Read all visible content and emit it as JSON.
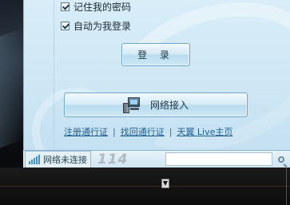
{
  "login": {
    "remember_password": "记住我的密码",
    "auto_login": "自动为我登录",
    "login_button": "登 录",
    "network_button": "网络接入"
  },
  "links": {
    "register": "注册通行证",
    "recover": "找回通行证",
    "tianyi_home": "天翼 Live主页",
    "separator": "|"
  },
  "statusbar": {
    "connection_status": "网络未连接",
    "number_label": "114",
    "search_value": ""
  },
  "icons": {
    "checkbox": "checkmark-icon",
    "network": "network-computer-icon",
    "signal": "signal-bars-icon",
    "search": "search-icon",
    "scroll": "chevron-down-icon"
  },
  "colors": {
    "panel_bg": "#cfe7f5",
    "link": "#1d5f93",
    "signal": "#3f92c9"
  }
}
